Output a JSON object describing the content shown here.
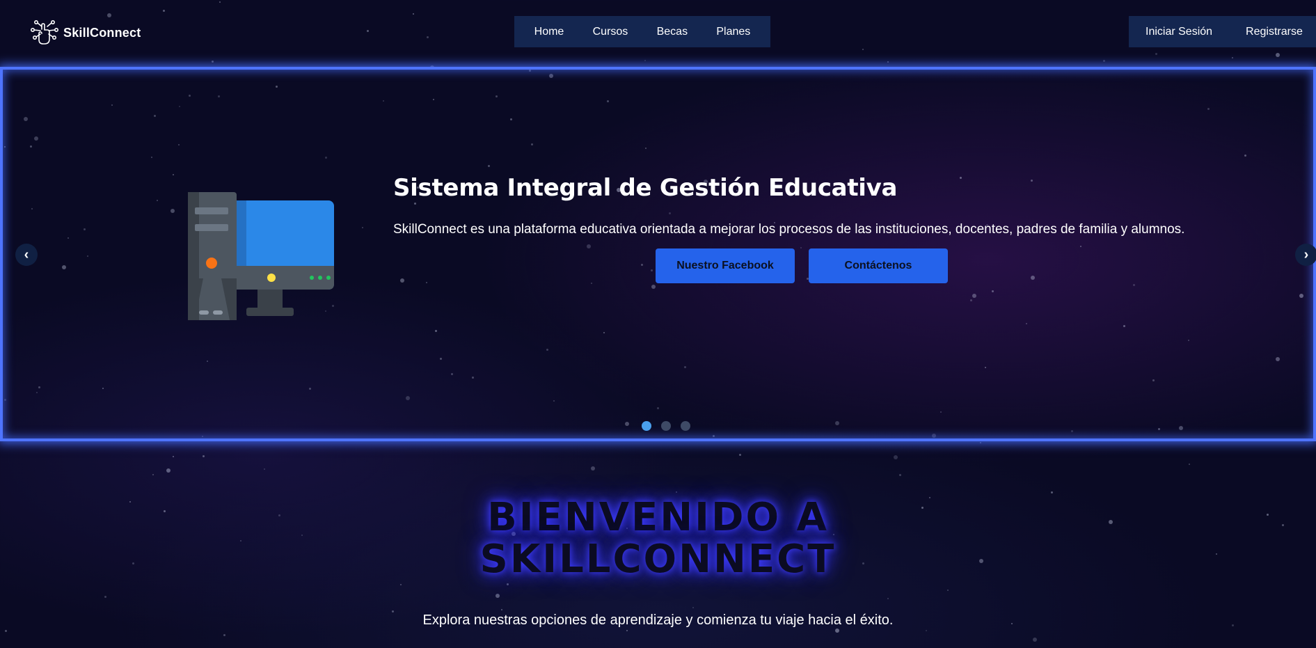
{
  "brand": {
    "name": "SkillConnect"
  },
  "nav": {
    "items": [
      "Home",
      "Cursos",
      "Becas",
      "Planes"
    ]
  },
  "auth": {
    "login": "Iniciar Sesión",
    "register": "Registrarse"
  },
  "hero": {
    "title": "Sistema Integral de Gestión Educativa",
    "description": "SkillConnect es una plataforma educativa orientada a mejorar los procesos de las instituciones, docentes, padres de familia y alumnos.",
    "buttons": {
      "facebook": "Nuestro Facebook",
      "contact": "Contáctenos"
    },
    "prev_arrow": "‹",
    "next_arrow": "›",
    "slide_count": 3,
    "active_slide": 1,
    "illustration": "desktop-computer-icon"
  },
  "welcome": {
    "title_line1": "BIENVENIDO A",
    "title_line2": "SKILLCONNECT",
    "subtitle": "Explora nuestras opciones de aprendizaje y comienza tu viaje hacia el éxito."
  },
  "colors": {
    "background": "#0a0a24",
    "nav_bg": "#142650",
    "accent_blue": "#2563eb",
    "glow_border": "#4f74ff",
    "active_dot": "#4aa0ee"
  }
}
